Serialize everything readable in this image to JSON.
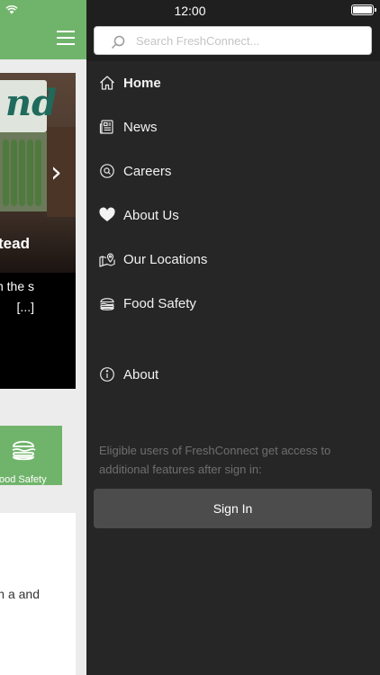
{
  "status_bar": {
    "time": "12:00"
  },
  "background": {
    "hero": {
      "title": "tead",
      "excerpt": "stead n in the s [...]"
    },
    "food_tile": {
      "label": "ood Safety"
    },
    "article": {
      "text": "ike the of the with a and"
    }
  },
  "drawer": {
    "search": {
      "placeholder": "Search FreshConnect..."
    },
    "nav_items": [
      {
        "label": "Home",
        "icon": "home-icon",
        "active": true
      },
      {
        "label": "News",
        "icon": "newspaper-icon"
      },
      {
        "label": "Careers",
        "icon": "careers-search-icon"
      },
      {
        "label": "About Us",
        "icon": "heart-icon"
      },
      {
        "label": "Our Locations",
        "icon": "map-pin-icon"
      },
      {
        "label": "Food Safety",
        "icon": "burger-icon"
      }
    ],
    "about": {
      "label": "About",
      "icon": "info-icon"
    },
    "signin_note": "Eligible users of FreshConnect get access to additional features after sign in:",
    "signin_button": "Sign In"
  },
  "colors": {
    "brand_green": "#70b46b",
    "drawer_bg": "#262626",
    "drawer_top": "#1f1f1f",
    "button_bg": "#4c4c4c"
  }
}
